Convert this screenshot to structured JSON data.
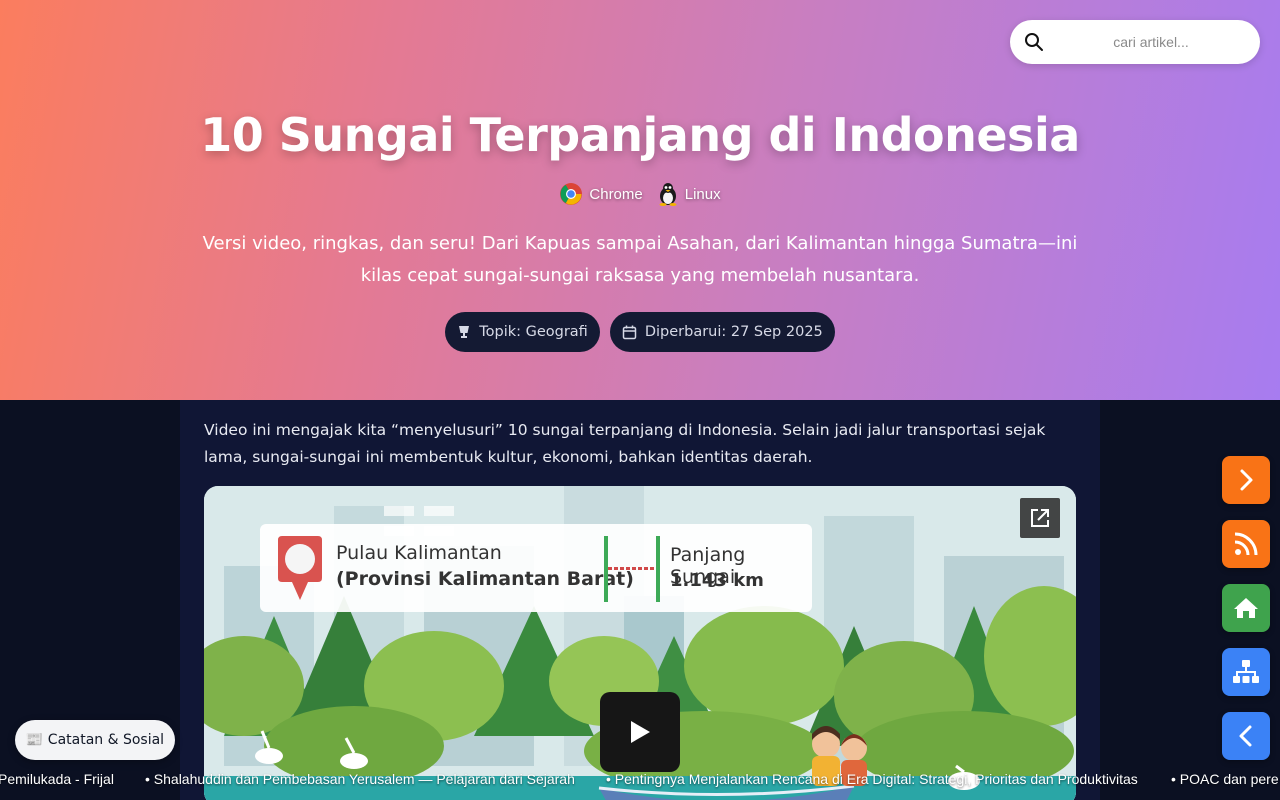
{
  "search": {
    "placeholder": "cari artikel..."
  },
  "header": {
    "title": "10 Sungai Terpanjang di Indonesia",
    "browsers": [
      {
        "label": "Chrome",
        "icon": "chrome-icon"
      },
      {
        "label": "Linux",
        "icon": "linux-icon"
      }
    ],
    "subtitle": "Versi video, ringkas, dan seru! Dari Kapuas sampai Asahan, dari Kalimantan hingga Sumatra—ini kilas cepat sungai-sungai raksasa yang membelah nusantara.",
    "badges": [
      {
        "label": "Topik: Geografi",
        "icon": "cup-icon"
      },
      {
        "label": "Diperbarui: 27 Sep 2025",
        "icon": "calendar-icon"
      }
    ]
  },
  "main": {
    "intro": "Video ini mengajak kita “menyelusuri” 10 sungai terpanjang di Indonesia. Selain jadi jalur transportasi sejak lama, sungai-sungai ini membentuk kultur, ekonomi, bahkan identitas daerah.",
    "video": {
      "location_line1": "Pulau Kalimantan",
      "location_line2": "(Provinsi Kalimantan Barat)",
      "length_label": "Panjang Sungai",
      "length_value": "1.143 km"
    }
  },
  "sidebar": {
    "buttons": [
      {
        "icon": "chevron-right-icon",
        "color": "#f97316"
      },
      {
        "icon": "rss-icon",
        "color": "#f97316"
      },
      {
        "icon": "home-icon",
        "color": "#3fa34d"
      },
      {
        "icon": "sitemap-icon",
        "color": "#3b82f6"
      },
      {
        "icon": "chevron-left-icon",
        "color": "#3b82f6"
      }
    ]
  },
  "pill": {
    "label": "📰 Catatan & Sosial"
  },
  "ticker": {
    "items": [
      "Pemilukada - Frijal",
      "• Shalahuddin dan Pembebasan Yerusalem — Pelajaran dari Sejarah",
      "• Pentingnya Menjalankan Rencana di Era Digital: Strategi, Prioritas dan Produktivitas",
      "• POAC dan pere"
    ]
  },
  "colors": {
    "hero_gradient_start": "#fb7d5e",
    "hero_gradient_end": "#a77cf0",
    "page_bg": "#0b1022",
    "content_bg": "#101635"
  }
}
